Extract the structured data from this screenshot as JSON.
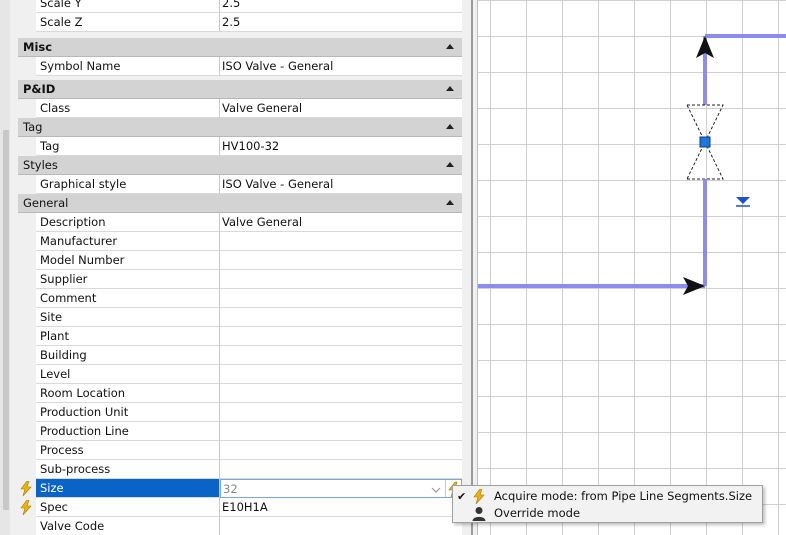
{
  "properties": {
    "top_rows": [
      {
        "name": "Scale Y",
        "value": "2.5"
      },
      {
        "name": "Scale Z",
        "value": "2.5"
      }
    ],
    "misc": {
      "title": "Misc",
      "symbol_name_label": "Symbol Name",
      "symbol_name_value": "ISO Valve - General"
    },
    "pid": {
      "title": "P&ID",
      "class_label": "Class",
      "class_value": "Valve General"
    },
    "tag": {
      "title": "Tag",
      "tag_label": "Tag",
      "tag_value": "HV100-32"
    },
    "styles": {
      "title": "Styles",
      "graphical_style_label": "Graphical style",
      "graphical_style_value": "ISO Valve - General"
    },
    "general": {
      "title": "General",
      "rows": [
        {
          "name": "Description",
          "value": "Valve General"
        },
        {
          "name": "Manufacturer",
          "value": ""
        },
        {
          "name": "Model Number",
          "value": ""
        },
        {
          "name": "Supplier",
          "value": ""
        },
        {
          "name": "Comment",
          "value": ""
        },
        {
          "name": "Site",
          "value": ""
        },
        {
          "name": "Plant",
          "value": ""
        },
        {
          "name": "Building",
          "value": ""
        },
        {
          "name": "Level",
          "value": ""
        },
        {
          "name": "Room Location",
          "value": ""
        },
        {
          "name": "Production Unit",
          "value": ""
        },
        {
          "name": "Production Line",
          "value": ""
        },
        {
          "name": "Process",
          "value": ""
        },
        {
          "name": "Sub-process",
          "value": ""
        }
      ],
      "size_label": "Size",
      "size_value": "32",
      "spec_label": "Spec",
      "spec_value": "E10H1A",
      "valve_code_label": "Valve Code",
      "valve_code_value": ""
    }
  },
  "context_menu": {
    "items": [
      {
        "label": "Acquire mode: from Pipe Line Segments.Size",
        "checked": "✔",
        "icon": "lightning-icon"
      },
      {
        "label": "Override mode",
        "checked": "",
        "icon": "user-icon"
      }
    ]
  },
  "colors": {
    "pipe": "#8c8cf0",
    "selection": "#0a64c8",
    "bolt": "#f0b400",
    "valve_grip": "#1e78dc"
  }
}
